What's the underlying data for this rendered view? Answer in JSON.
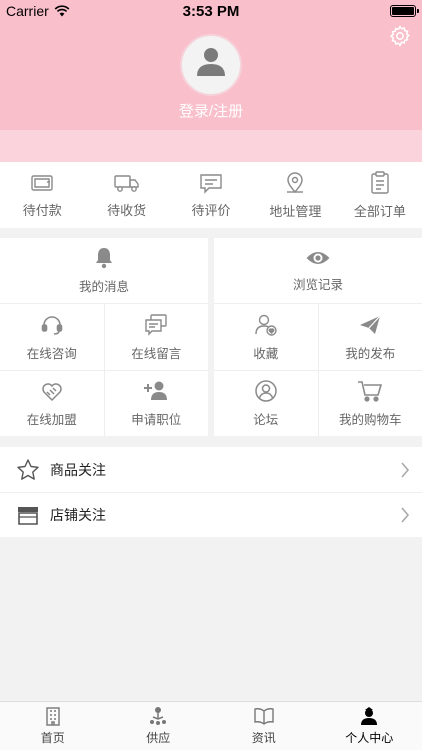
{
  "status_bar": {
    "carrier": "Carrier",
    "time": "3:53 PM"
  },
  "profile": {
    "login_label": "登录/注册"
  },
  "orders": [
    {
      "label": "待付款",
      "icon": "wallet-icon"
    },
    {
      "label": "待收货",
      "icon": "truck-icon"
    },
    {
      "label": "待评价",
      "icon": "comment-icon"
    },
    {
      "label": "地址管理",
      "icon": "location-pin-icon"
    },
    {
      "label": "全部订单",
      "icon": "clipboard-icon"
    }
  ],
  "left_panel": {
    "top": {
      "label": "我的消息",
      "icon": "bell-icon"
    },
    "cells": [
      {
        "label": "在线咨询",
        "icon": "headset-icon"
      },
      {
        "label": "在线留言",
        "icon": "message-board-icon"
      },
      {
        "label": "在线加盟",
        "icon": "handshake-heart-icon"
      },
      {
        "label": "申请职位",
        "icon": "add-user-icon"
      }
    ]
  },
  "right_panel": {
    "top": {
      "label": "浏览记录",
      "icon": "eye-icon"
    },
    "cells": [
      {
        "label": "收藏",
        "icon": "user-favorite-icon"
      },
      {
        "label": "我的发布",
        "icon": "paper-plane-icon"
      },
      {
        "label": "论坛",
        "icon": "forum-user-icon"
      },
      {
        "label": "我的购物车",
        "icon": "cart-icon"
      }
    ]
  },
  "follow_list": [
    {
      "label": "商品关注",
      "icon": "star-icon"
    },
    {
      "label": "店铺关注",
      "icon": "shop-icon"
    }
  ],
  "tabbar": [
    {
      "label": "首页",
      "icon": "building-icon"
    },
    {
      "label": "供应",
      "icon": "supply-icon"
    },
    {
      "label": "资讯",
      "icon": "book-icon"
    },
    {
      "label": "个人中心",
      "icon": "person-icon",
      "active": true
    }
  ],
  "colors": {
    "header": "#f9bfcb",
    "header_band": "#fad3dc",
    "icon_gray": "#8a8a8a",
    "background": "#f2f2f2"
  }
}
